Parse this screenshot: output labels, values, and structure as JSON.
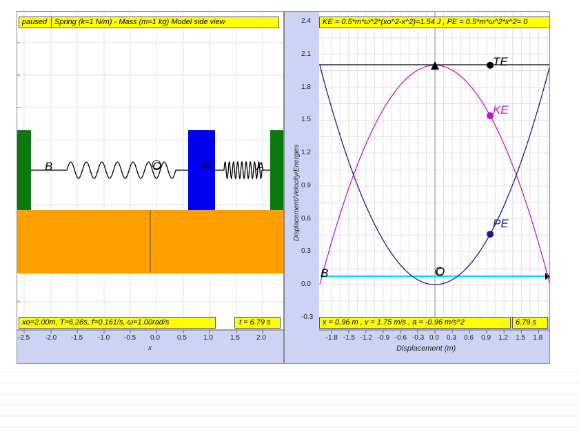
{
  "left_panel": {
    "status": "paused",
    "title": "Spring (k=1 N/m) - Mass (m=1 kg) Model side view",
    "params": "xo=2.00m, T=6.28s, f=0.161/s, ω=1.00rad/s",
    "time": "t = 6.79 s",
    "x_axis_label": "x",
    "x_ticks": [
      "-2.5",
      "-2.0",
      "-1.5",
      "-1.0",
      "-0.5",
      "0.0",
      "0.5",
      "1.0",
      "1.5",
      "2.0"
    ],
    "labels": {
      "B": "B",
      "O": "O",
      "P": "P",
      "A": "A"
    }
  },
  "right_panel": {
    "energy_header": "KE = 0.5*m*ω^2*(xo^2-x^2)=1.54 J , PE = 0.5*m*ω^2*x^2= 0",
    "readout": "x = 0.96 m , v = 1.75 m/s , a = -0.96 m/s^2",
    "time": "6.79 s",
    "y_axis_label": "Displacement/Velocity/Energies",
    "x_axis_label": "Displacement (m)",
    "y_ticks": [
      "2.4",
      "2.1",
      "1.8",
      "1.5",
      "1.2",
      "0.9",
      "0.6",
      "0.3",
      "0.0",
      "-0.3"
    ],
    "x_ticks": [
      "-1.8",
      "-1.5",
      "-1.2",
      "-0.9",
      "-0.6",
      "-0.3",
      "0.0",
      "0.3",
      "0.6",
      "0.9",
      "1.2",
      "1.5",
      "1.8"
    ],
    "labels": {
      "TE": "TE",
      "KE": "KE",
      "PE": "PE",
      "B": "B",
      "O": "O"
    },
    "colors": {
      "KE": "#cc11cc",
      "PE": "#1a1a8c",
      "TE": "#000000",
      "displacement": "#00e5ff"
    }
  },
  "chart_data": {
    "type": "line",
    "xlabel": "Displacement (m)",
    "ylabel": "Displacement/Velocity/Energies",
    "xlim": [
      -2.0,
      2.0
    ],
    "ylim": [
      -0.3,
      2.4
    ],
    "series": [
      {
        "name": "KE",
        "formula": "0.5*(4-x^2)",
        "marker": {
          "x": 0.96,
          "y": 1.54
        }
      },
      {
        "name": "PE",
        "formula": "0.5*x^2",
        "marker": {
          "x": 0.96,
          "y": 0.46
        }
      },
      {
        "name": "TE",
        "formula": "2.0",
        "marker": {
          "x": 0.96,
          "y": 2.0
        }
      }
    ]
  }
}
